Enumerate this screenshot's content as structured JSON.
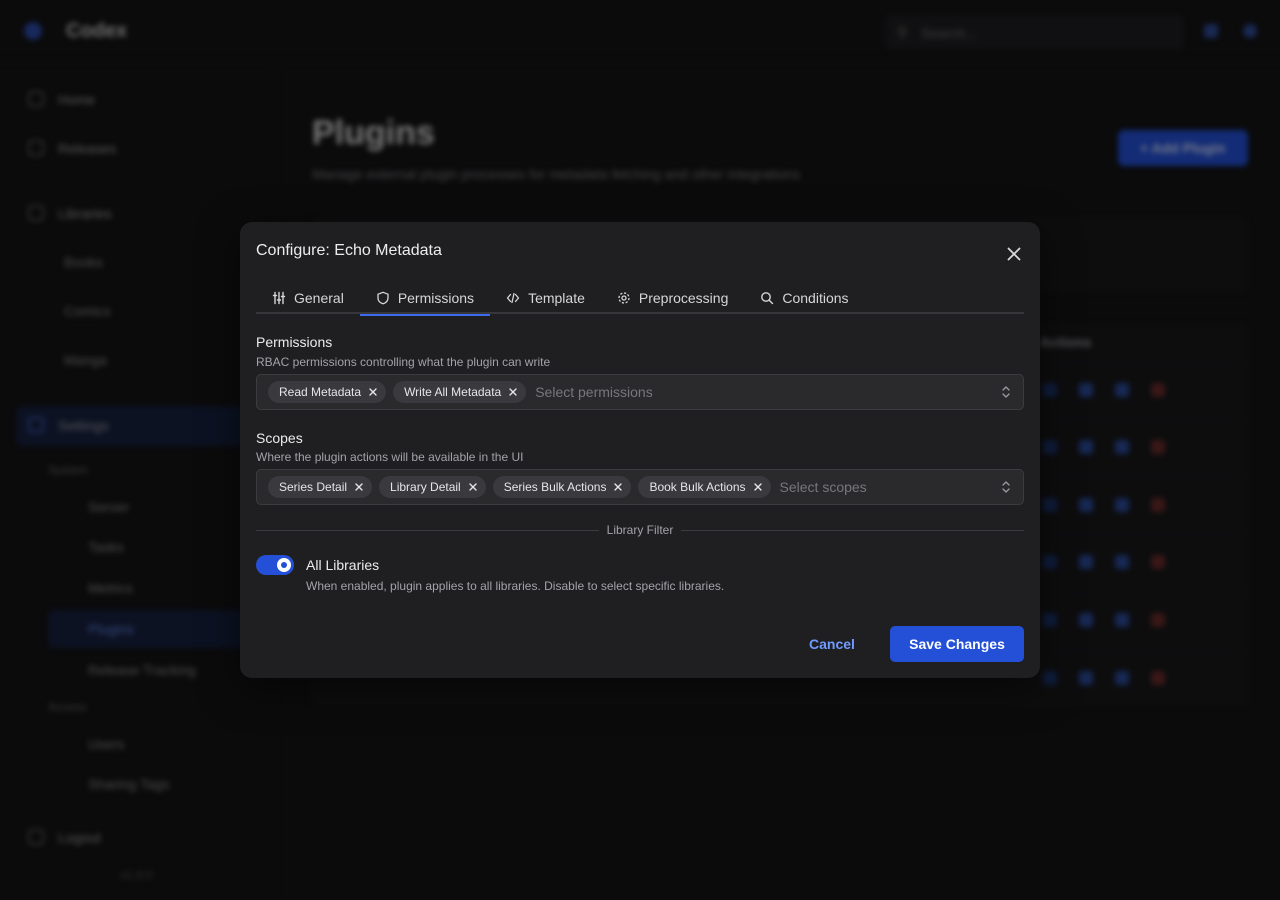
{
  "background": {
    "app_name": "Codex",
    "search_placeholder": "Search...",
    "nav": {
      "home": "Home",
      "releases": "Releases",
      "libraries": "Libraries",
      "books": "Books",
      "comics": "Comics",
      "manga": "Manga",
      "settings": "Settings",
      "system_section": "System",
      "server": "Server",
      "tasks": "Tasks",
      "metrics": "Metrics",
      "plugins": "Plugins",
      "release_tracking": "Release Tracking",
      "access_section": "Access",
      "users": "Users",
      "sharing_tags": "Sharing Tags",
      "logout": "Logout",
      "version": "v1.0.0"
    },
    "page": {
      "title": "Plugins",
      "subtitle": "Manage external plugin processes for metadata fetching and other integrations",
      "add_button": "Add Plugin",
      "actions_header": "Actions"
    }
  },
  "modal": {
    "title": "Configure: Echo Metadata",
    "tabs": [
      {
        "label": "General"
      },
      {
        "label": "Permissions"
      },
      {
        "label": "Template"
      },
      {
        "label": "Preprocessing"
      },
      {
        "label": "Conditions"
      }
    ],
    "active_tab": "Permissions",
    "permissions": {
      "label": "Permissions",
      "description": "RBAC permissions controlling what the plugin can write",
      "selected": [
        "Read Metadata",
        "Write All Metadata"
      ],
      "placeholder": "Select permissions"
    },
    "scopes": {
      "label": "Scopes",
      "description": "Where the plugin actions will be available in the UI",
      "selected": [
        "Series Detail",
        "Library Detail",
        "Series Bulk Actions",
        "Book Bulk Actions"
      ],
      "placeholder": "Select scopes"
    },
    "library_filter": {
      "divider_label": "Library Filter",
      "toggle_label": "All Libraries",
      "toggle_description": "When enabled, plugin applies to all libraries. Disable to select specific libraries.",
      "enabled": true
    },
    "cancel_label": "Cancel",
    "save_label": "Save Changes",
    "colors": {
      "accent": "#2350d6",
      "link": "#6f9bff",
      "surface": "#1f1f21"
    }
  }
}
